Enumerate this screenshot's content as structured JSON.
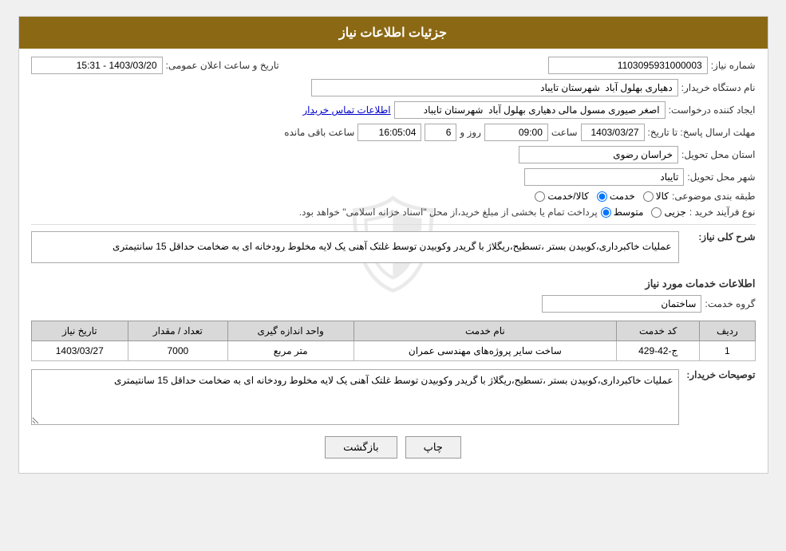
{
  "header": {
    "title": "جزئیات اطلاعات نیاز"
  },
  "fields": {
    "shomareNiaz_label": "شماره نیاز:",
    "shomareNiaz_value": "1103095931000003",
    "namDastgah_label": "نام دستگاه خریدار:",
    "namDastgah_value": "دهیاری بهلول آباد  شهرستان تایباد",
    "ijadKonande_label": "ایجاد کننده درخواست:",
    "ijadKonande_value": "اصغر صیوری مسول مالی دهیاری بهلول آباد  شهرستان تایباد",
    "etelaat_link": "اطلاعات تماس خریدار",
    "mohlat_label": "مهلت ارسال پاسخ: تا تاریخ:",
    "mohlat_date": "1403/03/27",
    "mohlat_saat_label": "ساعت",
    "mohlat_saat_value": "09:00",
    "mohlat_roz_label": "روز و",
    "mohlat_roz_value": "6",
    "mohlat_baqi_label": "ساعت باقی مانده",
    "mohlat_baqi_value": "16:05:04",
    "ostan_label": "استان محل تحویل:",
    "ostan_value": "خراسان رضوی",
    "shahr_label": "شهر محل تحویل:",
    "shahr_value": "تایباد",
    "tabaqe_label": "طبقه بندی موضوعی:",
    "tabaqe_options": [
      {
        "label": "کالا",
        "value": "kala"
      },
      {
        "label": "خدمت",
        "value": "khedmat"
      },
      {
        "label": "کالا/خدمت",
        "value": "kala_khedmat"
      }
    ],
    "tabaqe_selected": "khedmat",
    "noeFarayand_label": "نوع فرآیند خرید :",
    "noeFarayand_options": [
      {
        "label": "جزیی",
        "value": "jozi"
      },
      {
        "label": "متوسط",
        "value": "motavaset"
      },
      {
        "label": "notice",
        "value": "notice"
      }
    ],
    "noeFarayand_selected": "motavaset",
    "noeFarayand_notice": "پرداخت تمام یا بخشی از مبلغ خرید،از محل \"اسناد خزانه اسلامی\" خواهد بود.",
    "tarikh_label": "تاریخ و ساعت اعلان عمومی:",
    "tarikh_value": "1403/03/20 - 15:31",
    "sharhKoli_label": "شرح کلی نیاز:",
    "sharhKoli_value": "عملیات خاکبرداری،کوبیدن بستر ،تسطیح،ریگلاژ با گریدر وکوبیدن توسط غلتک آهنی یک لایه مخلوط رودخانه ای به ضخامت حداقل 15 سانتیمتری",
    "etelaat_khadamat_label": "اطلاعات خدمات مورد نیاز",
    "grohe_khadamat_label": "گروه خدمت:",
    "grohe_khadamat_value": "ساختمان",
    "table_headers": [
      "ردیف",
      "کد خدمت",
      "نام خدمت",
      "واحد اندازه گیری",
      "تعداد / مقدار",
      "تاریخ نیاز"
    ],
    "table_rows": [
      {
        "radif": "1",
        "kod": "ج-42-429",
        "naam": "ساخت سایر پروژه‌های مهندسی عمران",
        "vahed": "متر مربع",
        "tedad": "7000",
        "tarikh": "1403/03/27"
      }
    ],
    "tosaif_label": "توصیحات خریدار:",
    "tosaif_value": "عملیات خاکبرداری،کوبیدن بستر ،تسطیح،ریگلاژ با گریدر وکوبیدن توسط غلتک آهنی یک لایه مخلوط رودخانه ای به ضخامت حداقل 15 سانتیمتری"
  },
  "buttons": {
    "print_label": "چاپ",
    "back_label": "بازگشت"
  }
}
